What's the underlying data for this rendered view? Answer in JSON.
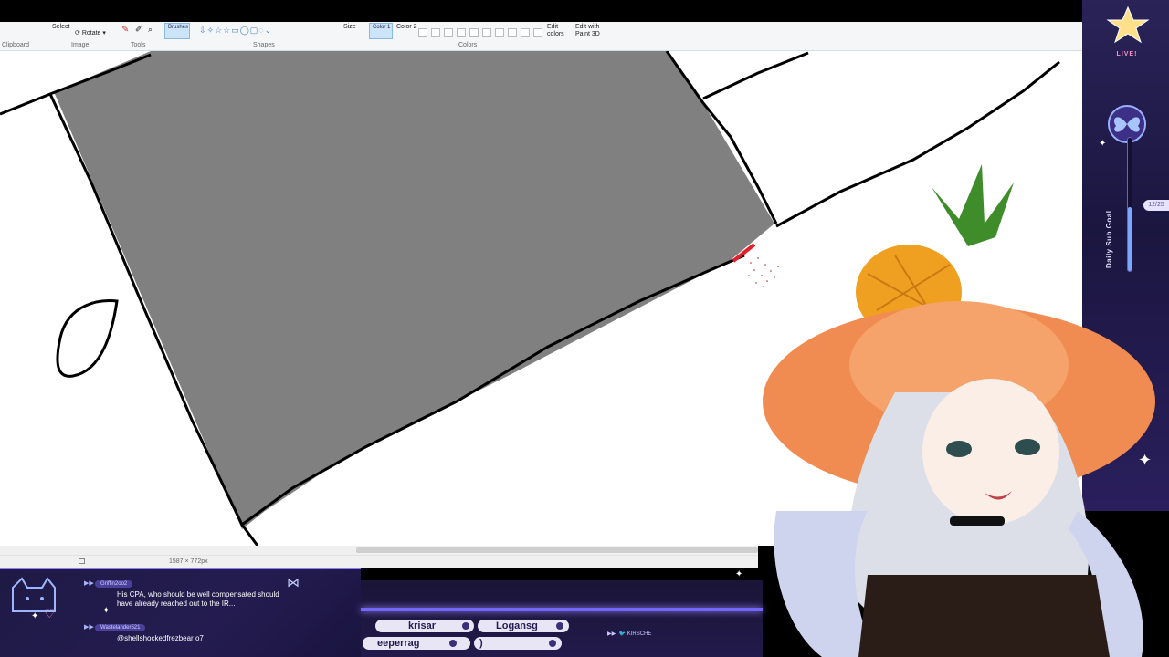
{
  "paint": {
    "ribbon": {
      "groups": [
        "Clipboard",
        "Image",
        "Tools",
        "Shapes",
        "Colors"
      ],
      "image_buttons": [
        "Select",
        "Rotate"
      ],
      "brushes_label": "Brushes",
      "size_label": "Size",
      "color1_label": "Color 1",
      "color2_label": "Color 2",
      "edit_colors_label": "Edit colors",
      "edit_paint3d_label": "Edit with Paint 3D"
    },
    "statusbar": {
      "dimensions": "1587 × 772px"
    },
    "colors": {
      "fill_gray": "#808080",
      "stroke": "#000000",
      "accent_red": "#e0202a"
    }
  },
  "overlay": {
    "live_label": "LIVE!",
    "sub_goal_label": "Daily Sub Goal",
    "sub_goal_count": "12/25",
    "sub_goal_progress": 0.48
  },
  "chat": {
    "messages": [
      {
        "user": "Griffin2oo2",
        "text": "His CPA, who should be well compensated should have already reached out to the IR..."
      },
      {
        "user": "Wastelander521",
        "text": "@shellshockedfrezbear o7"
      }
    ]
  },
  "ticker": {
    "names": [
      "krisar",
      "Logansg",
      "eeperrag",
      ")"
    ],
    "twitter_handle": "KIRSCHE"
  }
}
